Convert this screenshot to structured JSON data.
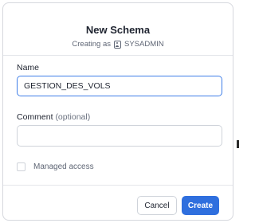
{
  "dialog": {
    "title": "New Schema",
    "subtitle_prefix": "Creating as",
    "role": "SYSADMIN",
    "role_icon": "user-badge-icon"
  },
  "form": {
    "name_label": "Name",
    "name_value": "GESTION_DES_VOLS",
    "comment_label": "Comment",
    "comment_optional": "(optional)",
    "comment_value": "",
    "managed_access_label": "Managed access",
    "managed_access_checked": false
  },
  "footer": {
    "cancel_label": "Cancel",
    "create_label": "Create"
  },
  "colors": {
    "accent": "#2f6fde",
    "focus_border": "#3f7ee8",
    "border": "#cfd3da",
    "muted_text": "#5f6675"
  }
}
